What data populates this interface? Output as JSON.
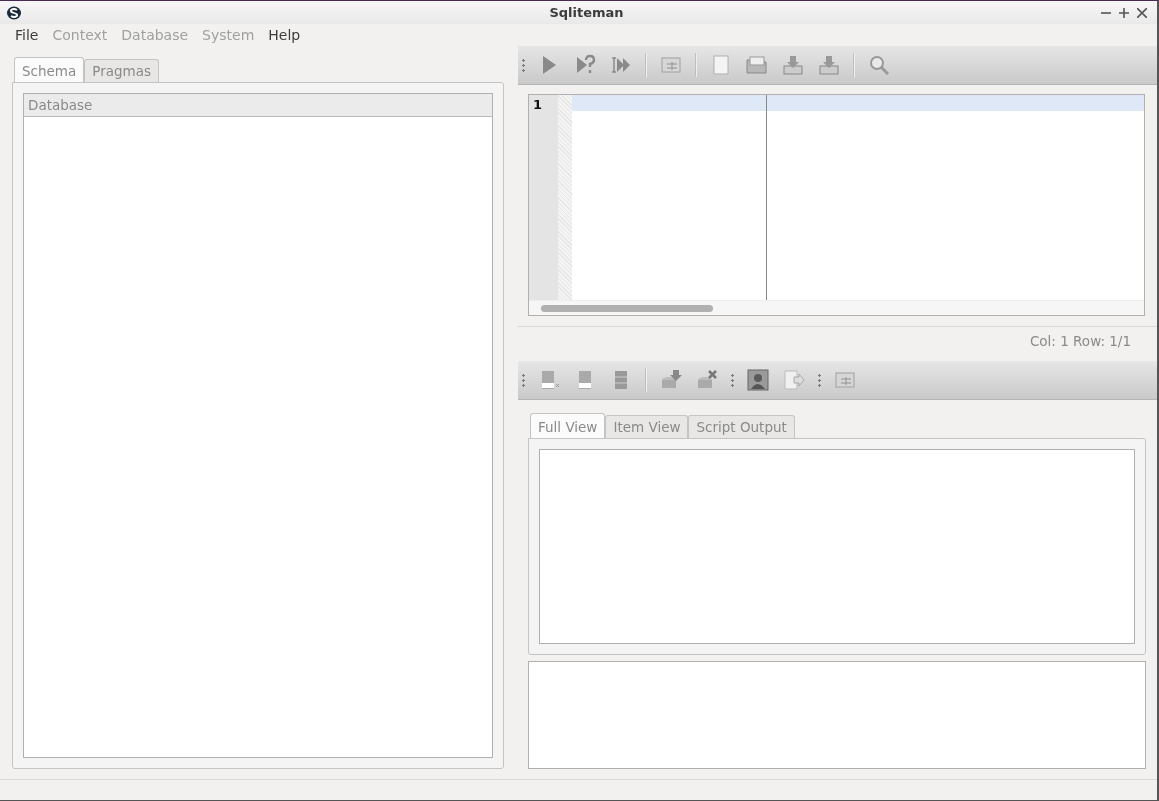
{
  "window": {
    "title": "Sqliteman"
  },
  "menu": [
    {
      "label": "File",
      "disabled": false
    },
    {
      "label": "Context",
      "disabled": true
    },
    {
      "label": "Database",
      "disabled": true
    },
    {
      "label": "System",
      "disabled": true
    },
    {
      "label": "Help",
      "disabled": false
    }
  ],
  "left_tabs": [
    {
      "label": "Schema",
      "selected": true
    },
    {
      "label": "Pragmas",
      "selected": false
    }
  ],
  "schema_tree": {
    "header": "Database"
  },
  "editor": {
    "line_numbers": [
      "1"
    ],
    "status": "Col: 1 Row: 1/1"
  },
  "result_tabs": [
    {
      "label": "Full View",
      "selected": true
    },
    {
      "label": "Item View",
      "selected": false
    },
    {
      "label": "Script Output",
      "selected": false
    }
  ]
}
